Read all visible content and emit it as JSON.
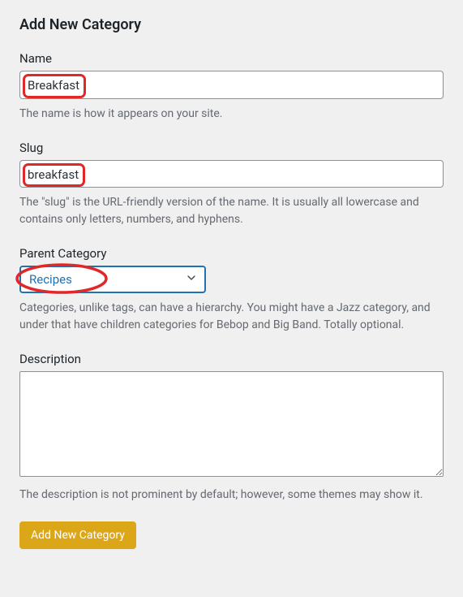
{
  "title": "Add New Category",
  "fields": {
    "name": {
      "label": "Name",
      "value": "Breakfast",
      "help": "The name is how it appears on your site."
    },
    "slug": {
      "label": "Slug",
      "value": "breakfast",
      "help": "The \"slug\" is the URL-friendly version of the name. It is usually all lowercase and contains only letters, numbers, and hyphens."
    },
    "parent": {
      "label": "Parent Category",
      "selected": "Recipes",
      "help": "Categories, unlike tags, can have a hierarchy. You might have a Jazz category, and under that have children categories for Bebop and Big Band. Totally optional."
    },
    "description": {
      "label": "Description",
      "value": "",
      "help": "The description is not prominent by default; however, some themes may show it."
    }
  },
  "submit_label": "Add New Category"
}
